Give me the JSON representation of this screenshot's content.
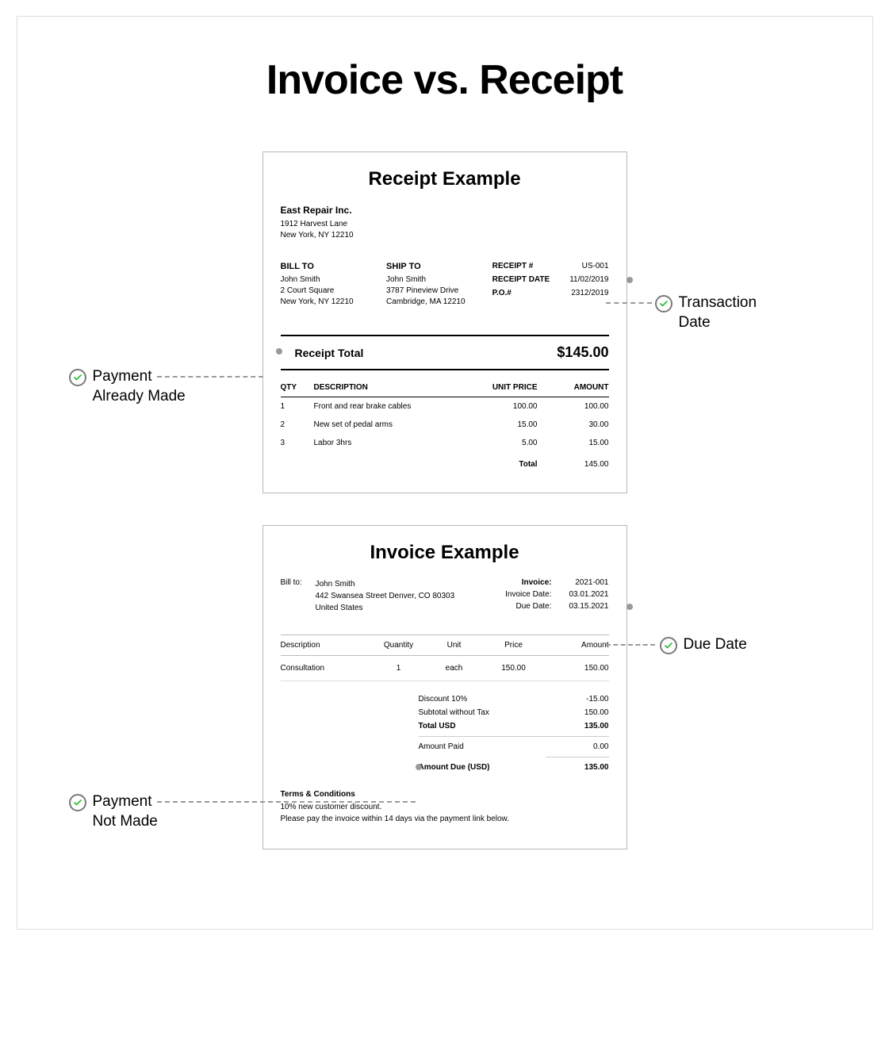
{
  "title": "Invoice vs. Receipt",
  "receipt": {
    "heading": "Receipt Example",
    "company": "East Repair Inc.",
    "addr1": "1912 Harvest Lane",
    "addr2": "New York, NY 12210",
    "billto_hdr": "BILL TO",
    "billto_name": "John Smith",
    "billto_l1": "2 Court Square",
    "billto_l2": "New York, NY 12210",
    "shipto_hdr": "SHIP TO",
    "shipto_name": "John Smith",
    "shipto_l1": "3787 Pineview Drive",
    "shipto_l2": "Cambridge, MA 12210",
    "meta_num_lbl": "RECEIPT #",
    "meta_num_val": "US-001",
    "meta_date_lbl": "RECEIPT DATE",
    "meta_date_val": "11/02/2019",
    "meta_po_lbl": "P.O.#",
    "meta_po_val": "2312/2019",
    "total_lbl": "Receipt Total",
    "total_val": "$145.00",
    "col_qty": "QTY",
    "col_desc": "DESCRIPTION",
    "col_unit": "UNIT PRICE",
    "col_amt": "AMOUNT",
    "items": [
      {
        "qty": "1",
        "desc": "Front and rear brake cables",
        "unit": "100.00",
        "amt": "100.00"
      },
      {
        "qty": "2",
        "desc": "New set of pedal arms",
        "unit": "15.00",
        "amt": "30.00"
      },
      {
        "qty": "3",
        "desc": "Labor 3hrs",
        "unit": "5.00",
        "amt": "15.00"
      }
    ],
    "foot_total_lbl": "Total",
    "foot_total_val": "145.00"
  },
  "invoice": {
    "heading": "Invoice Example",
    "billto_lbl": "Bill to:",
    "billto_name": "John Smith",
    "billto_l1": "442 Swansea Street Denver, CO 80303",
    "billto_l2": "United States",
    "inv_lbl": "Invoice:",
    "inv_val": "2021-001",
    "invdate_lbl": "Invoice Date:",
    "invdate_val": "03.01.2021",
    "duedate_lbl": "Due Date:",
    "duedate_val": "03.15.2021",
    "col_desc": "Description",
    "col_qty": "Quantity",
    "col_unit": "Unit",
    "col_price": "Price",
    "col_amt": "Amount",
    "items": [
      {
        "desc": "Consultation",
        "qty": "1",
        "unit": "each",
        "price": "150.00",
        "amt": "150.00"
      }
    ],
    "disc_lbl": "Discount 10%",
    "disc_val": "-15.00",
    "sub_lbl": "Subtotal without Tax",
    "sub_val": "150.00",
    "totusd_lbl": "Total USD",
    "totusd_val": "135.00",
    "paid_lbl": "Amount Paid",
    "paid_val": "0.00",
    "due_lbl": "Amount Due (USD)",
    "due_val": "135.00",
    "terms_hdr": "Terms & Conditions",
    "terms_l1": "10% new customer discount.",
    "terms_l2": "Please pay the invoice within 14 days via the payment link below."
  },
  "callouts": {
    "payment_made": "Payment\nAlready Made",
    "transaction_date": "Transaction\nDate",
    "due_date": "Due Date",
    "payment_not_made": "Payment\nNot Made"
  }
}
